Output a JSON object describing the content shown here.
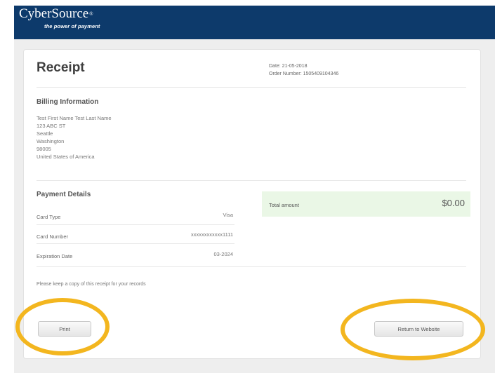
{
  "header": {
    "brand": "CyberSource",
    "brand_mark": "®",
    "tagline": "the power of payment"
  },
  "receipt": {
    "title": "Receipt",
    "date": "Date: 21-05-2018",
    "order_number": "Order Number: 1505409104346"
  },
  "billing": {
    "title": "Billing Information",
    "lines": [
      "Test First Name Test Last Name",
      "123 ABC ST",
      "Seattle",
      "Washington",
      "98005",
      "United States of America"
    ]
  },
  "payment": {
    "title": "Payment Details",
    "rows": [
      {
        "label": "Card Type",
        "value": "Visa"
      },
      {
        "label": "Card Number",
        "value": "xxxxxxxxxxxx1111"
      },
      {
        "label": "Expiration Date",
        "value": "03-2024"
      }
    ]
  },
  "total": {
    "label": "Total amount",
    "amount": "$0.00"
  },
  "note": "Please keep a copy of this receipt for your records",
  "actions": {
    "print": "Print",
    "return": "Return to Website"
  },
  "colors": {
    "header": "#0d3a6b",
    "highlight_ring": "#f3b61f",
    "total_bg": "#eaf7e6"
  }
}
